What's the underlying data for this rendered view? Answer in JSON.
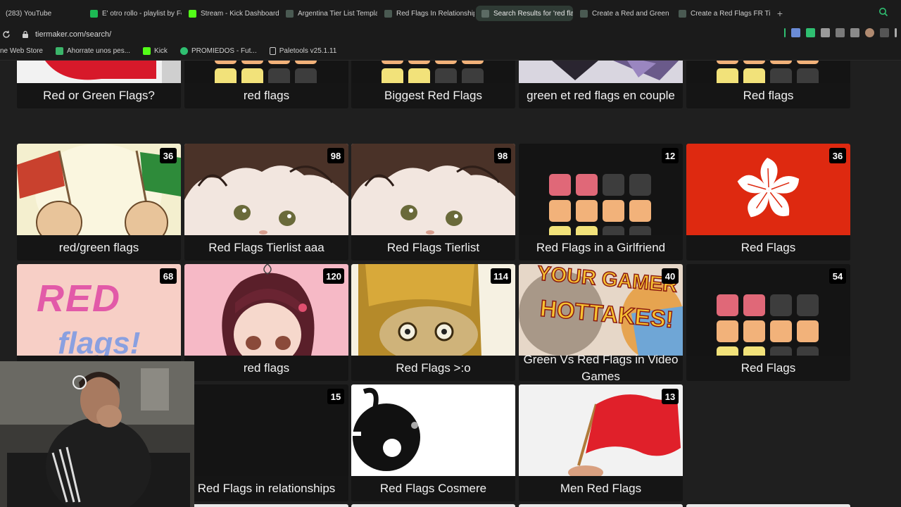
{
  "tabs": [
    {
      "label": "(283) YouTube",
      "fav_color": "#ff0000",
      "active": false
    },
    {
      "label": "E' otro rollo - playlist by Fe",
      "fav_color": "#1db954",
      "active": false
    },
    {
      "label": "Stream - Kick Dashboard",
      "fav_color": "#53fc18",
      "active": false
    },
    {
      "label": "Argentina Tier List Templa",
      "fav_color": "#4a5a52",
      "active": false
    },
    {
      "label": "Red Flags In Relationship",
      "fav_color": "#4a5a52",
      "active": false
    },
    {
      "label": "Search Results for 'red fla",
      "fav_color": "#5c6b64",
      "active": true
    },
    {
      "label": "Create a Red and Green Fl",
      "fav_color": "#4a5a52",
      "active": false
    },
    {
      "label": "Create a Red Flags FR Tier",
      "fav_color": "#4a5a52",
      "active": false
    }
  ],
  "new_tab_label": "+",
  "url": "tiermaker.com/search/",
  "bookmarks": [
    {
      "label": "ne Web Store",
      "icon": "none"
    },
    {
      "label": "Ahorrate unos pes...",
      "icon": "puzzle-icon"
    },
    {
      "label": "Kick",
      "icon": "kick-icon"
    },
    {
      "label": "PROMIEDOS - Fut...",
      "icon": "soccer-icon"
    },
    {
      "label": "Paletools v25.1.11",
      "icon": "page-icon"
    }
  ],
  "colors": {
    "tile_red": "#e06878",
    "tile_orange": "#f2b27a",
    "tile_yellow": "#f2e27a",
    "tile_gray": "#3d3d3d",
    "accent_tab": "#2f3b35"
  },
  "cards": [
    {
      "title": "Red or Green Flags?",
      "count": "",
      "thumb": "flag-red-white"
    },
    {
      "title": "red flags",
      "count": "",
      "thumb": "tier-grid"
    },
    {
      "title": "Biggest Red Flags",
      "count": "",
      "thumb": "tier-grid"
    },
    {
      "title": "green et red flags en couple",
      "count": "",
      "thumb": "purple-photo"
    },
    {
      "title": "Red flags",
      "count": "",
      "thumb": "tier-grid"
    },
    {
      "title": "red/green flags",
      "count": "36",
      "thumb": "hands-flags"
    },
    {
      "title": "Red Flags Tierlist aaa",
      "count": "98",
      "thumb": "anime-face"
    },
    {
      "title": "Red Flags Tierlist",
      "count": "98",
      "thumb": "anime-face"
    },
    {
      "title": "Red Flags in a Girlfriend",
      "count": "12",
      "thumb": "tier-grid"
    },
    {
      "title": "Red Flags",
      "count": "36",
      "thumb": "hong-kong"
    },
    {
      "title": "",
      "count": "68",
      "thumb": "red-flags-text"
    },
    {
      "title": "red flags",
      "count": "120",
      "thumb": "pink-anime"
    },
    {
      "title": "Red Flags >:o",
      "count": "114",
      "thumb": "yellow-face"
    },
    {
      "title": "Green Vs Red Flags in Video Games",
      "count": "40",
      "thumb": "gamer-hottakes"
    },
    {
      "title": "Red Flags",
      "count": "54",
      "thumb": "tier-grid"
    },
    {
      "title": "Red Flags",
      "count": "",
      "thumb": "tier-grid"
    },
    {
      "title": "Red Flags in relationships",
      "count": "15",
      "thumb": "blank"
    },
    {
      "title": "Red Flags Cosmere",
      "count": "",
      "thumb": "cosmere-symbol"
    },
    {
      "title": "Men Red Flags",
      "count": "13",
      "thumb": "waving-flag"
    }
  ],
  "thumb_text": {
    "red_flags_line1": "RED",
    "red_flags_line2": "flags!",
    "gamer_line1": "YOUR GAMER",
    "gamer_line2": "HOTTAKES!"
  }
}
